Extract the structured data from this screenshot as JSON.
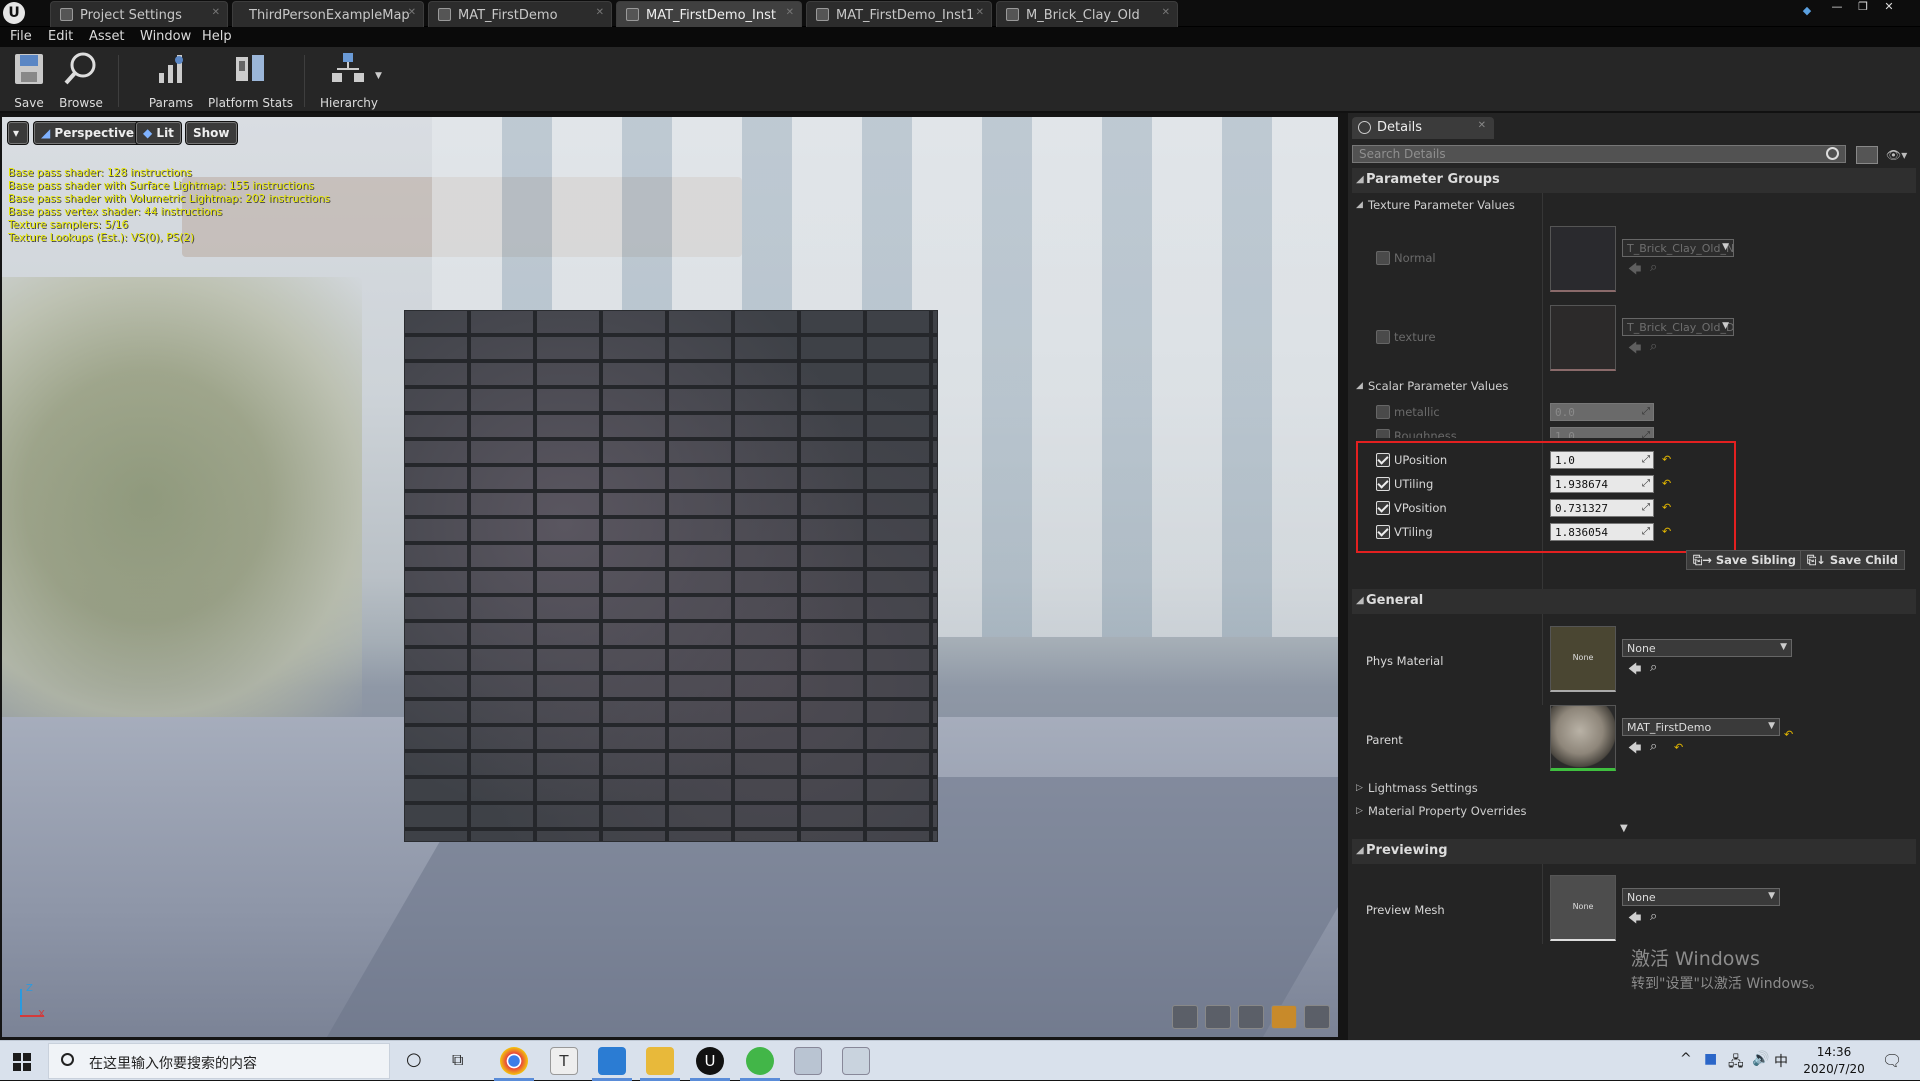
{
  "tabs": [
    {
      "label": "Project Settings",
      "active": false
    },
    {
      "label": "ThirdPersonExampleMap",
      "active": false
    },
    {
      "label": "MAT_FirstDemo",
      "active": false
    },
    {
      "label": "MAT_FirstDemo_Inst",
      "active": true
    },
    {
      "label": "MAT_FirstDemo_Inst1",
      "active": false
    },
    {
      "label": "M_Brick_Clay_Old",
      "active": false
    }
  ],
  "menu": [
    "File",
    "Edit",
    "Asset",
    "Window",
    "Help"
  ],
  "toolbar": {
    "save": "Save",
    "browse": "Browse",
    "params": "Params",
    "platform_stats": "Platform Stats",
    "hierarchy": "Hierarchy"
  },
  "viewport": {
    "perspective": "Perspective",
    "lit": "Lit",
    "show": "Show",
    "stats": [
      "Base pass shader: 128 instructions",
      "Base pass shader with Surface Lightmap: 155 instructions",
      "Base pass shader with Volumetric Lightmap: 202 instructions",
      "Base pass vertex shader: 44 instructions",
      "Texture samplers: 5/16",
      "Texture Lookups (Est.): VS(0), PS(2)"
    ],
    "axis_z": "Z",
    "axis_x": "X"
  },
  "details": {
    "tab_title": "Details",
    "search_placeholder": "Search Details",
    "parameter_groups": "Parameter Groups",
    "texture_params_header": "Texture Parameter Values",
    "texture_params": [
      {
        "name": "Normal",
        "asset": "T_Brick_Clay_Old_N"
      },
      {
        "name": "texture",
        "asset": "T_Brick_Clay_Old_D"
      }
    ],
    "scalar_params_header": "Scalar Parameter Values",
    "scalar_params": [
      {
        "name": "metallic",
        "value": "0.0",
        "enabled": false
      },
      {
        "name": "Roughness",
        "value": "1.0",
        "enabled": false
      },
      {
        "name": "UPosition",
        "value": "1.0",
        "enabled": true
      },
      {
        "name": "UTiling",
        "value": "1.938674",
        "enabled": true
      },
      {
        "name": "VPosition",
        "value": "0.731327",
        "enabled": true
      },
      {
        "name": "VTiling",
        "value": "1.836054",
        "enabled": true
      }
    ],
    "save_sibling": "Save Sibling",
    "save_child": "Save Child",
    "general_header": "General",
    "phys_material_label": "Phys Material",
    "phys_material_thumb": "None",
    "phys_material_value": "None",
    "parent_label": "Parent",
    "parent_value": "MAT_FirstDemo",
    "lightmass_settings": "Lightmass Settings",
    "material_property_overrides": "Material Property Overrides",
    "previewing_header": "Previewing",
    "preview_mesh_label": "Preview Mesh",
    "preview_mesh_thumb": "None",
    "preview_mesh_value": "None"
  },
  "watermark": {
    "line1": "激活 Windows",
    "line2": "转到\"设置\"以激活 Windows。"
  },
  "taskbar": {
    "search_placeholder": "在这里输入你要搜索的内容",
    "time": "14:36",
    "date": "2020/7/20",
    "ime": "中"
  },
  "colors": {
    "highlight_box": "#e32020",
    "reset_arrow": "#e5b800",
    "stats_text": "#e6e600"
  }
}
